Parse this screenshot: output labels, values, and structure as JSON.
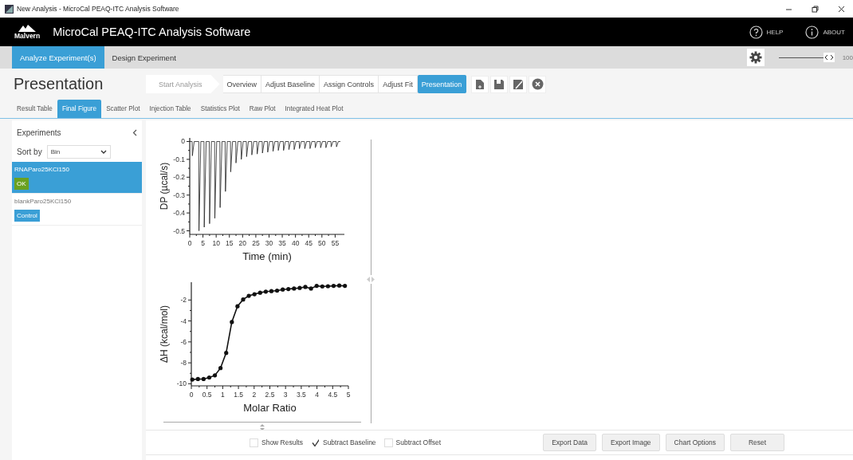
{
  "window": {
    "title": "New Analysis - MicroCal PEAQ-ITC Analysis Software"
  },
  "header": {
    "logo_text": "Malvern",
    "app_title": "MicroCal PEAQ-ITC Analysis Software",
    "links": [
      {
        "label": "HELP",
        "kind": "help"
      },
      {
        "label": "ABOUT",
        "kind": "about"
      }
    ]
  },
  "nav": {
    "tabs": [
      {
        "label": "Analyze Experiment(s)",
        "selected": true
      },
      {
        "label": "Design Experiment",
        "selected": false
      }
    ],
    "zoom": {
      "level": 1,
      "reading": "100"
    }
  },
  "page_title": "Presentation",
  "steps": [
    {
      "label": "Start Analysis",
      "disabled": true,
      "selected": false
    },
    {
      "label": "Overview",
      "disabled": false,
      "selected": false
    },
    {
      "label": "Adjust Baseline",
      "disabled": false,
      "selected": false
    },
    {
      "label": "Assign Controls",
      "disabled": false,
      "selected": false
    },
    {
      "label": "Adjust Fit",
      "disabled": false,
      "selected": false
    },
    {
      "label": "Presentation",
      "disabled": false,
      "selected": true
    }
  ],
  "subtabs": [
    {
      "label": "Result Table",
      "selected": false
    },
    {
      "label": "Final Figure",
      "selected": true
    },
    {
      "label": "Scatter Plot",
      "selected": false
    },
    {
      "label": "Injection Table",
      "selected": false
    },
    {
      "label": "Statistics Plot",
      "selected": false
    },
    {
      "label": "Raw Plot",
      "selected": false
    },
    {
      "label": "Integrated Heat Plot",
      "selected": false
    }
  ],
  "sidebar": {
    "title": "Experiments",
    "sort_label": "Sort by",
    "sort_value": "Bin",
    "items": [
      {
        "name": "RNAParo25KCl150",
        "badge": "OK",
        "kind": "ok",
        "selected": true
      },
      {
        "name": "blankParo25KCl150",
        "badge": "Control",
        "kind": "control",
        "selected": false
      }
    ]
  },
  "figure": {
    "charts": [
      {
        "markers": false,
        "chart_data": {
          "type": "line",
          "xlabel": "Time (min)",
          "ylabel": "DP (µcal/s)",
          "xlim": [
            0,
            58.5
          ],
          "ylim": [
            -0.52,
            0.02
          ],
          "xticks": [
            0,
            5,
            10,
            15,
            20,
            25,
            30,
            35,
            40,
            45,
            50,
            55
          ],
          "yticks": [
            0,
            -0.1,
            -0.2,
            -0.3,
            -0.4,
            -0.5
          ],
          "x": [
            0,
            0.9,
            1,
            1.7,
            3.4,
            3.5,
            4.2,
            5.4,
            5.5,
            6.2,
            7.4,
            7.5,
            8.2,
            9.4,
            9.5,
            10.2,
            11.4,
            11.5,
            12.2,
            13.4,
            13.5,
            14.2,
            15.4,
            15.5,
            16.2,
            17.4,
            17.5,
            18.2,
            19.4,
            19.5,
            20.2,
            21.4,
            21.5,
            22.2,
            23.4,
            23.5,
            24.2,
            25.4,
            25.5,
            26.2,
            27.4,
            27.5,
            28.2,
            29.4,
            29.5,
            30.2,
            31.4,
            31.5,
            32.2,
            33.4,
            33.5,
            34.2,
            35.4,
            35.5,
            36.2,
            37.4,
            37.5,
            38.2,
            39.4,
            39.5,
            40.2,
            41.4,
            41.5,
            42.2,
            43.4,
            43.5,
            44.2,
            45.4,
            45.5,
            46.2,
            47.4,
            47.5,
            48.2,
            49.4,
            49.5,
            50.2,
            51.4,
            51.5,
            52.2,
            53.4,
            53.5,
            54.2,
            55.4,
            55.5,
            56.2,
            57
          ],
          "series": [
            {
              "color": "#222222",
              "values": [
                0,
                0,
                -0.08,
                0,
                0,
                -0.5,
                0,
                0,
                -0.48,
                0,
                0,
                -0.46,
                0,
                0,
                -0.43,
                0,
                0,
                -0.37,
                0,
                0,
                -0.28,
                0,
                0,
                -0.17,
                0,
                0,
                -0.12,
                0,
                0,
                -0.1,
                0,
                0,
                -0.085,
                0,
                0,
                -0.075,
                0,
                0,
                -0.07,
                0,
                0,
                -0.065,
                0,
                0,
                -0.06,
                0,
                0,
                -0.055,
                0,
                0,
                -0.05,
                0,
                0,
                -0.05,
                0,
                0,
                -0.045,
                0,
                0,
                -0.045,
                0,
                0,
                -0.04,
                0,
                0,
                -0.04,
                0,
                0,
                -0.04,
                0,
                0,
                -0.035,
                0,
                0,
                -0.035,
                0,
                0,
                -0.035,
                0,
                0,
                -0.03,
                0,
                0,
                -0.03,
                0,
                0
              ]
            }
          ]
        }
      },
      {
        "markers": true,
        "chart_data": {
          "type": "line",
          "xlabel": "Molar Ratio",
          "ylabel": "ΔH (kcal/mol)",
          "xlim": [
            0,
            5
          ],
          "ylim": [
            -10.2,
            -0.3
          ],
          "xticks": [
            0,
            0.5,
            1,
            1.5,
            2,
            2.5,
            3,
            3.5,
            4,
            4.5,
            5
          ],
          "yticks": [
            -10,
            -8,
            -6,
            -4,
            -2
          ],
          "x": [
            0.03,
            0.21,
            0.39,
            0.57,
            0.75,
            0.93,
            1.11,
            1.29,
            1.47,
            1.65,
            1.83,
            2.01,
            2.19,
            2.37,
            2.55,
            2.73,
            2.91,
            3.09,
            3.27,
            3.45,
            3.63,
            3.81,
            3.99,
            4.17,
            4.35,
            4.53,
            4.71,
            4.89
          ],
          "series": [
            {
              "color": "#111111",
              "values": [
                -9.6,
                -9.55,
                -9.55,
                -9.4,
                -9.2,
                -8.5,
                -7.05,
                -4.1,
                -2.6,
                -1.95,
                -1.6,
                -1.45,
                -1.3,
                -1.2,
                -1.15,
                -1.1,
                -1,
                -0.95,
                -0.9,
                -0.85,
                -0.75,
                -0.9,
                -0.65,
                -0.7,
                -0.68,
                -0.65,
                -0.62,
                -0.65
              ]
            }
          ]
        }
      }
    ]
  },
  "options": [
    {
      "label": "Show Results",
      "checked": false
    },
    {
      "label": "Subtract Baseline",
      "checked": true
    },
    {
      "label": "Subtract Offset",
      "checked": false
    }
  ],
  "buttons": [
    "Export Data",
    "Export Image",
    "Chart Options",
    "Reset"
  ]
}
